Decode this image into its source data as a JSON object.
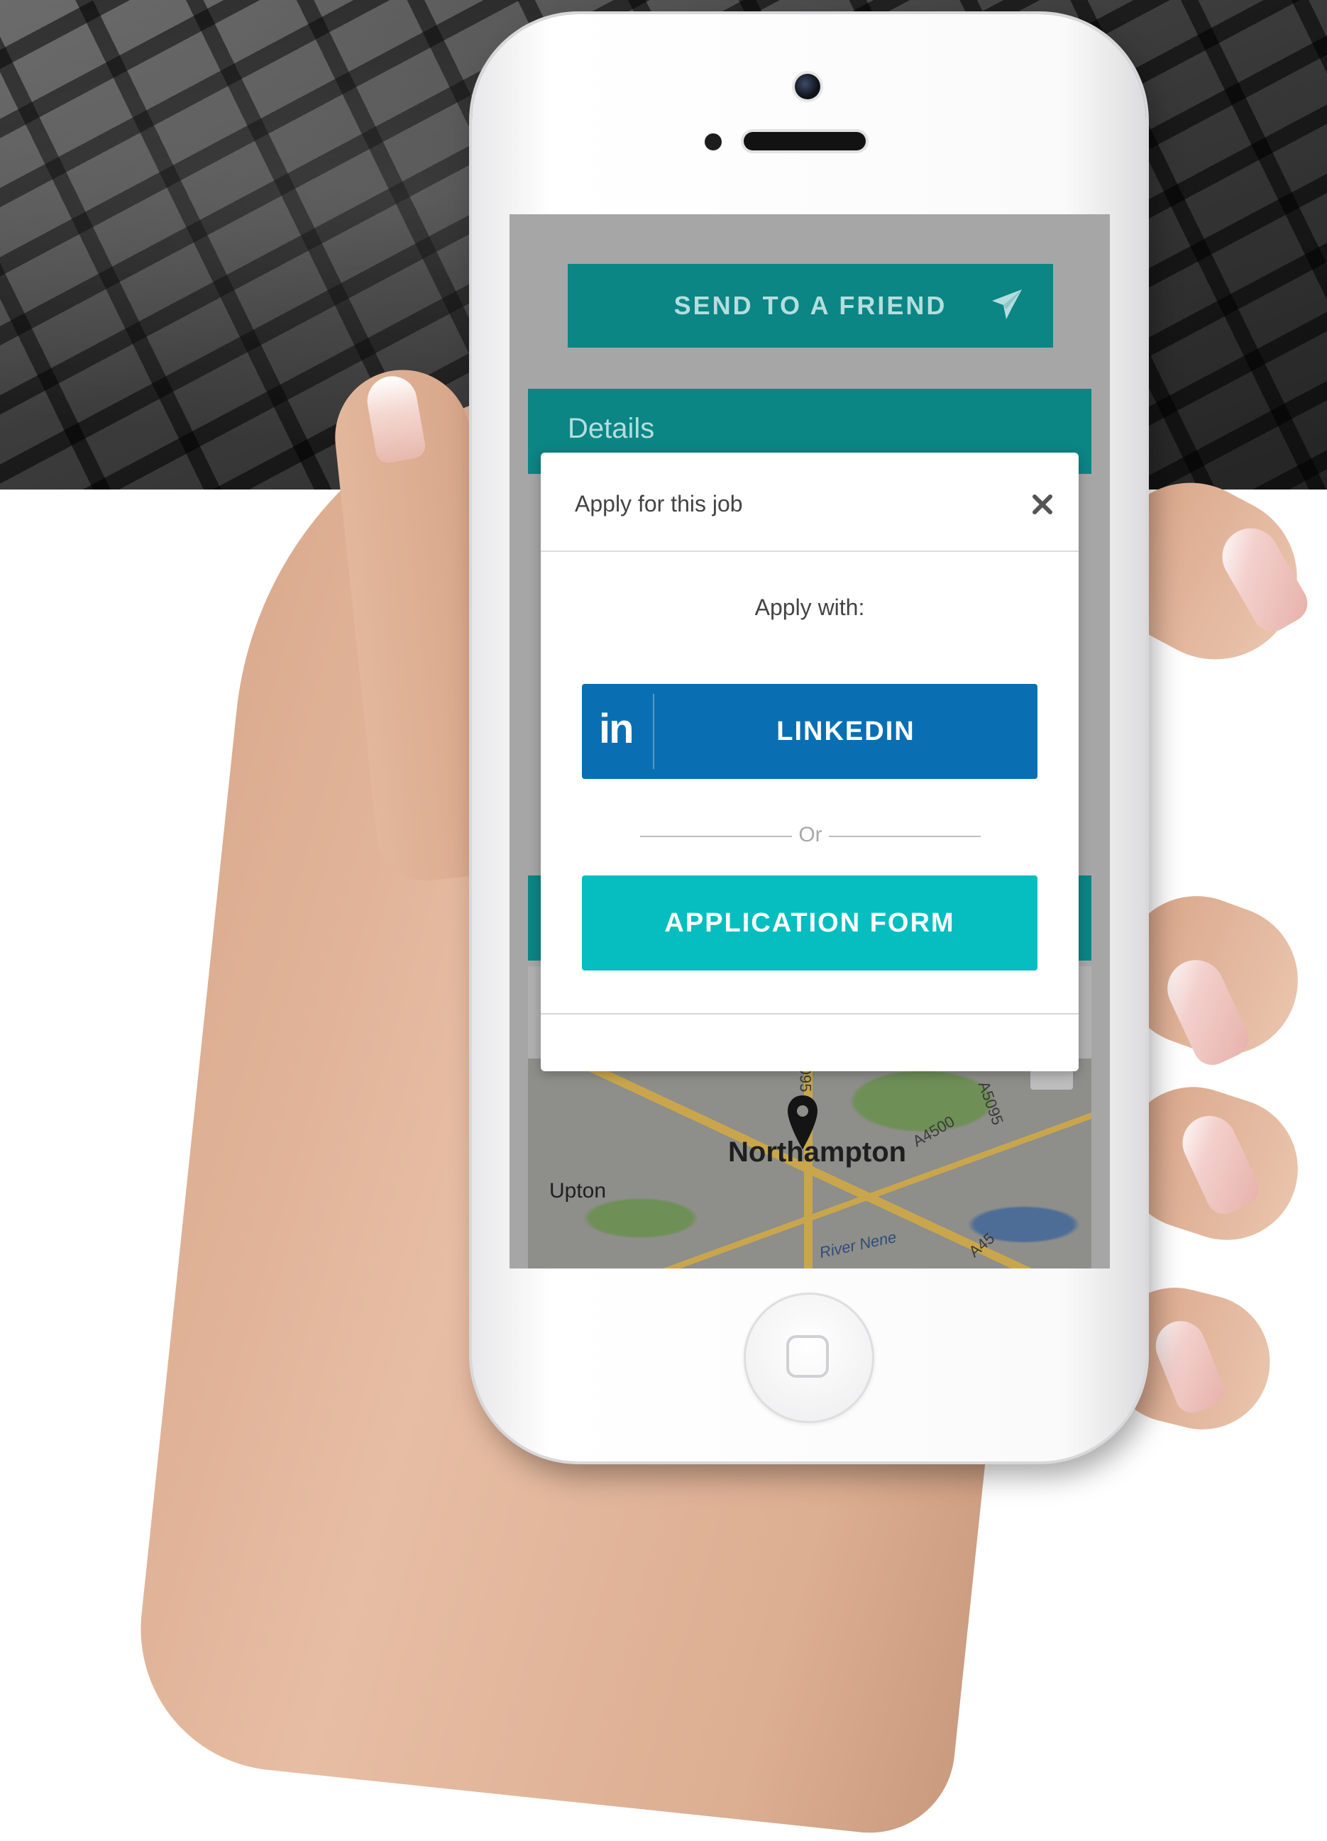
{
  "screen": {
    "send_button_label": "SEND TO A FRIEND",
    "details_title": "Details"
  },
  "modal": {
    "title": "Apply for this job",
    "subtitle": "Apply with:",
    "linkedin_logo": "in",
    "linkedin_label": "LINKEDIN",
    "separator_text": "Or",
    "form_label": "APPLICATION FORM",
    "colors": {
      "linkedin": "#0a6fb2",
      "form": "#06bec0",
      "teal": "#0c8585"
    }
  },
  "map": {
    "city": "Northampton",
    "town": "Upton",
    "river": "River Nene",
    "roads": [
      "A4500",
      "A5095",
      "A45",
      "095"
    ]
  },
  "icons": {
    "send": "paper-plane-icon",
    "close": "close-icon",
    "pin": "map-pin-icon"
  }
}
